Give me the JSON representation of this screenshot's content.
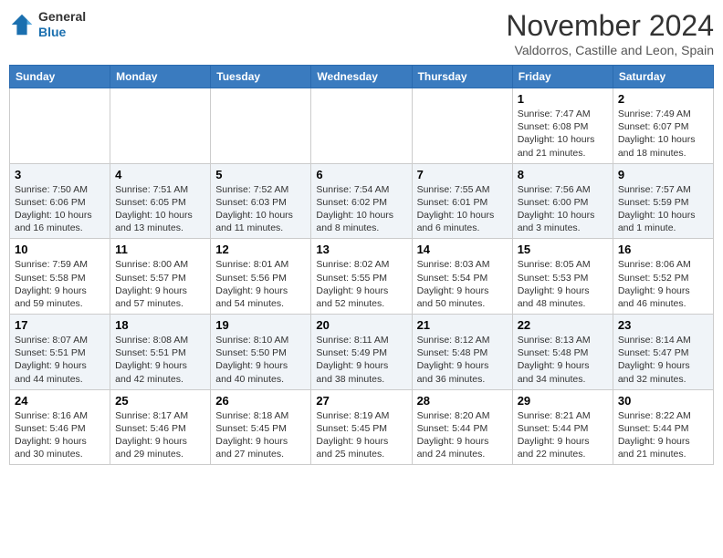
{
  "header": {
    "logo_line1": "General",
    "logo_line2": "Blue",
    "month": "November 2024",
    "location": "Valdorros, Castille and Leon, Spain"
  },
  "weekdays": [
    "Sunday",
    "Monday",
    "Tuesday",
    "Wednesday",
    "Thursday",
    "Friday",
    "Saturday"
  ],
  "weeks": [
    [
      {
        "day": "",
        "info": ""
      },
      {
        "day": "",
        "info": ""
      },
      {
        "day": "",
        "info": ""
      },
      {
        "day": "",
        "info": ""
      },
      {
        "day": "",
        "info": ""
      },
      {
        "day": "1",
        "info": "Sunrise: 7:47 AM\nSunset: 6:08 PM\nDaylight: 10 hours\nand 21 minutes."
      },
      {
        "day": "2",
        "info": "Sunrise: 7:49 AM\nSunset: 6:07 PM\nDaylight: 10 hours\nand 18 minutes."
      }
    ],
    [
      {
        "day": "3",
        "info": "Sunrise: 7:50 AM\nSunset: 6:06 PM\nDaylight: 10 hours\nand 16 minutes."
      },
      {
        "day": "4",
        "info": "Sunrise: 7:51 AM\nSunset: 6:05 PM\nDaylight: 10 hours\nand 13 minutes."
      },
      {
        "day": "5",
        "info": "Sunrise: 7:52 AM\nSunset: 6:03 PM\nDaylight: 10 hours\nand 11 minutes."
      },
      {
        "day": "6",
        "info": "Sunrise: 7:54 AM\nSunset: 6:02 PM\nDaylight: 10 hours\nand 8 minutes."
      },
      {
        "day": "7",
        "info": "Sunrise: 7:55 AM\nSunset: 6:01 PM\nDaylight: 10 hours\nand 6 minutes."
      },
      {
        "day": "8",
        "info": "Sunrise: 7:56 AM\nSunset: 6:00 PM\nDaylight: 10 hours\nand 3 minutes."
      },
      {
        "day": "9",
        "info": "Sunrise: 7:57 AM\nSunset: 5:59 PM\nDaylight: 10 hours\nand 1 minute."
      }
    ],
    [
      {
        "day": "10",
        "info": "Sunrise: 7:59 AM\nSunset: 5:58 PM\nDaylight: 9 hours\nand 59 minutes."
      },
      {
        "day": "11",
        "info": "Sunrise: 8:00 AM\nSunset: 5:57 PM\nDaylight: 9 hours\nand 57 minutes."
      },
      {
        "day": "12",
        "info": "Sunrise: 8:01 AM\nSunset: 5:56 PM\nDaylight: 9 hours\nand 54 minutes."
      },
      {
        "day": "13",
        "info": "Sunrise: 8:02 AM\nSunset: 5:55 PM\nDaylight: 9 hours\nand 52 minutes."
      },
      {
        "day": "14",
        "info": "Sunrise: 8:03 AM\nSunset: 5:54 PM\nDaylight: 9 hours\nand 50 minutes."
      },
      {
        "day": "15",
        "info": "Sunrise: 8:05 AM\nSunset: 5:53 PM\nDaylight: 9 hours\nand 48 minutes."
      },
      {
        "day": "16",
        "info": "Sunrise: 8:06 AM\nSunset: 5:52 PM\nDaylight: 9 hours\nand 46 minutes."
      }
    ],
    [
      {
        "day": "17",
        "info": "Sunrise: 8:07 AM\nSunset: 5:51 PM\nDaylight: 9 hours\nand 44 minutes."
      },
      {
        "day": "18",
        "info": "Sunrise: 8:08 AM\nSunset: 5:51 PM\nDaylight: 9 hours\nand 42 minutes."
      },
      {
        "day": "19",
        "info": "Sunrise: 8:10 AM\nSunset: 5:50 PM\nDaylight: 9 hours\nand 40 minutes."
      },
      {
        "day": "20",
        "info": "Sunrise: 8:11 AM\nSunset: 5:49 PM\nDaylight: 9 hours\nand 38 minutes."
      },
      {
        "day": "21",
        "info": "Sunrise: 8:12 AM\nSunset: 5:48 PM\nDaylight: 9 hours\nand 36 minutes."
      },
      {
        "day": "22",
        "info": "Sunrise: 8:13 AM\nSunset: 5:48 PM\nDaylight: 9 hours\nand 34 minutes."
      },
      {
        "day": "23",
        "info": "Sunrise: 8:14 AM\nSunset: 5:47 PM\nDaylight: 9 hours\nand 32 minutes."
      }
    ],
    [
      {
        "day": "24",
        "info": "Sunrise: 8:16 AM\nSunset: 5:46 PM\nDaylight: 9 hours\nand 30 minutes."
      },
      {
        "day": "25",
        "info": "Sunrise: 8:17 AM\nSunset: 5:46 PM\nDaylight: 9 hours\nand 29 minutes."
      },
      {
        "day": "26",
        "info": "Sunrise: 8:18 AM\nSunset: 5:45 PM\nDaylight: 9 hours\nand 27 minutes."
      },
      {
        "day": "27",
        "info": "Sunrise: 8:19 AM\nSunset: 5:45 PM\nDaylight: 9 hours\nand 25 minutes."
      },
      {
        "day": "28",
        "info": "Sunrise: 8:20 AM\nSunset: 5:44 PM\nDaylight: 9 hours\nand 24 minutes."
      },
      {
        "day": "29",
        "info": "Sunrise: 8:21 AM\nSunset: 5:44 PM\nDaylight: 9 hours\nand 22 minutes."
      },
      {
        "day": "30",
        "info": "Sunrise: 8:22 AM\nSunset: 5:44 PM\nDaylight: 9 hours\nand 21 minutes."
      }
    ]
  ]
}
